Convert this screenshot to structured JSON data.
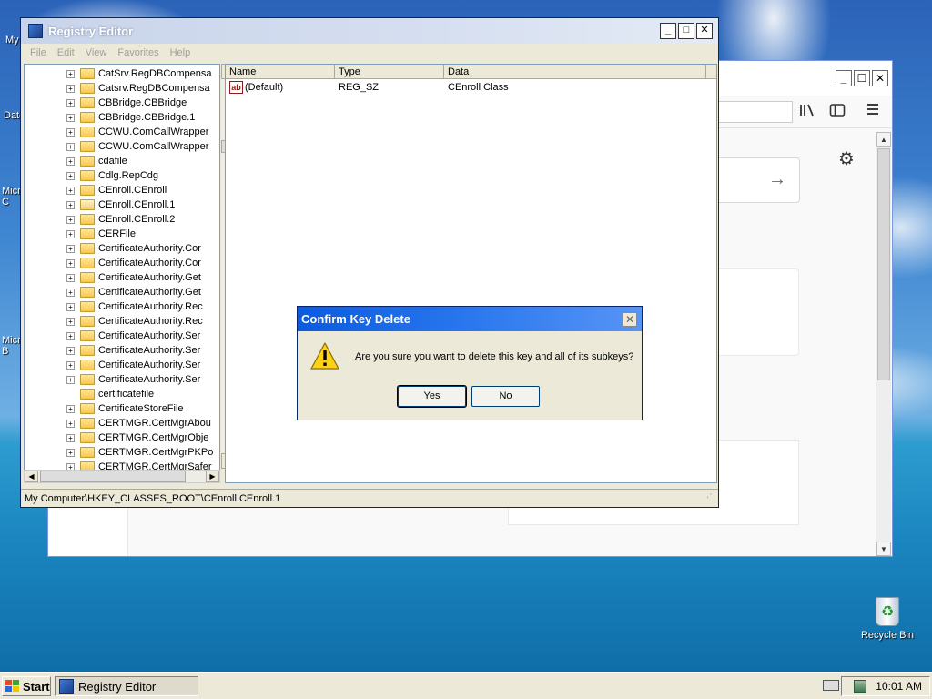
{
  "desktop": {
    "icon_labels": [
      "My",
      "Date",
      "Micro C",
      "Micro B"
    ],
    "recycle_bin_label": "Recycle Bin"
  },
  "browser": {
    "min_glyph": "_",
    "max_glyph": "☐",
    "close_glyph": "✕",
    "toolbar_icons": [
      "library-icon",
      "sidebar-icon",
      "menu-icon"
    ],
    "go_arrow": "→",
    "gear_glyph": "⚙"
  },
  "regedit": {
    "title": "Registry Editor",
    "menu": [
      "File",
      "Edit",
      "View",
      "Favorites",
      "Help"
    ],
    "tree_items": [
      {
        "label": "CatSrv.RegDBCompensa",
        "expander": "+",
        "open": false
      },
      {
        "label": "Catsrv.RegDBCompensa",
        "expander": "+",
        "open": false
      },
      {
        "label": "CBBridge.CBBridge",
        "expander": "+",
        "open": false
      },
      {
        "label": "CBBridge.CBBridge.1",
        "expander": "+",
        "open": false
      },
      {
        "label": "CCWU.ComCallWrapper",
        "expander": "+",
        "open": false
      },
      {
        "label": "CCWU.ComCallWrapper",
        "expander": "+",
        "open": false
      },
      {
        "label": "cdafile",
        "expander": "+",
        "open": false
      },
      {
        "label": "Cdlg.RepCdg",
        "expander": "+",
        "open": false
      },
      {
        "label": "CEnroll.CEnroll",
        "expander": "+",
        "open": false
      },
      {
        "label": "CEnroll.CEnroll.1",
        "expander": "+",
        "open": true
      },
      {
        "label": "CEnroll.CEnroll.2",
        "expander": "+",
        "open": false
      },
      {
        "label": "CERFile",
        "expander": "+",
        "open": false
      },
      {
        "label": "CertificateAuthority.Cor",
        "expander": "+",
        "open": false
      },
      {
        "label": "CertificateAuthority.Cor",
        "expander": "+",
        "open": false
      },
      {
        "label": "CertificateAuthority.Get",
        "expander": "+",
        "open": false
      },
      {
        "label": "CertificateAuthority.Get",
        "expander": "+",
        "open": false
      },
      {
        "label": "CertificateAuthority.Rec",
        "expander": "+",
        "open": false
      },
      {
        "label": "CertificateAuthority.Rec",
        "expander": "+",
        "open": false
      },
      {
        "label": "CertificateAuthority.Ser",
        "expander": "+",
        "open": false
      },
      {
        "label": "CertificateAuthority.Ser",
        "expander": "+",
        "open": false
      },
      {
        "label": "CertificateAuthority.Ser",
        "expander": "+",
        "open": false
      },
      {
        "label": "CertificateAuthority.Ser",
        "expander": "+",
        "open": false
      },
      {
        "label": "certificatefile",
        "expander": "",
        "open": false
      },
      {
        "label": "CertificateStoreFile",
        "expander": "+",
        "open": false
      },
      {
        "label": "CERTMGR.CertMgrAbou",
        "expander": "+",
        "open": false
      },
      {
        "label": "CERTMGR.CertMgrObje",
        "expander": "+",
        "open": false
      },
      {
        "label": "CERTMGR.CertMgrPKPo",
        "expander": "+",
        "open": false
      },
      {
        "label": "CERTMGR.CertMgrSafer",
        "expander": "+",
        "open": false
      }
    ],
    "values_columns": [
      "Name",
      "Type",
      "Data"
    ],
    "values": [
      {
        "name": "(Default)",
        "type": "REG_SZ",
        "data": "CEnroll Class",
        "icon": "ab"
      }
    ],
    "status_path": "My Computer\\HKEY_CLASSES_ROOT\\CEnroll.CEnroll.1"
  },
  "dialog": {
    "title": "Confirm Key Delete",
    "message": "Are you sure you want to delete this key and all of its subkeys?",
    "yes_label": "Yes",
    "no_label": "No",
    "close_glyph": "✕"
  },
  "taskbar": {
    "start_label": "Start",
    "task_label": "Registry Editor",
    "clock": "10:01 AM"
  },
  "colors": {
    "dialog_title": "#0a5be0",
    "xp_face": "#ece9d8"
  }
}
